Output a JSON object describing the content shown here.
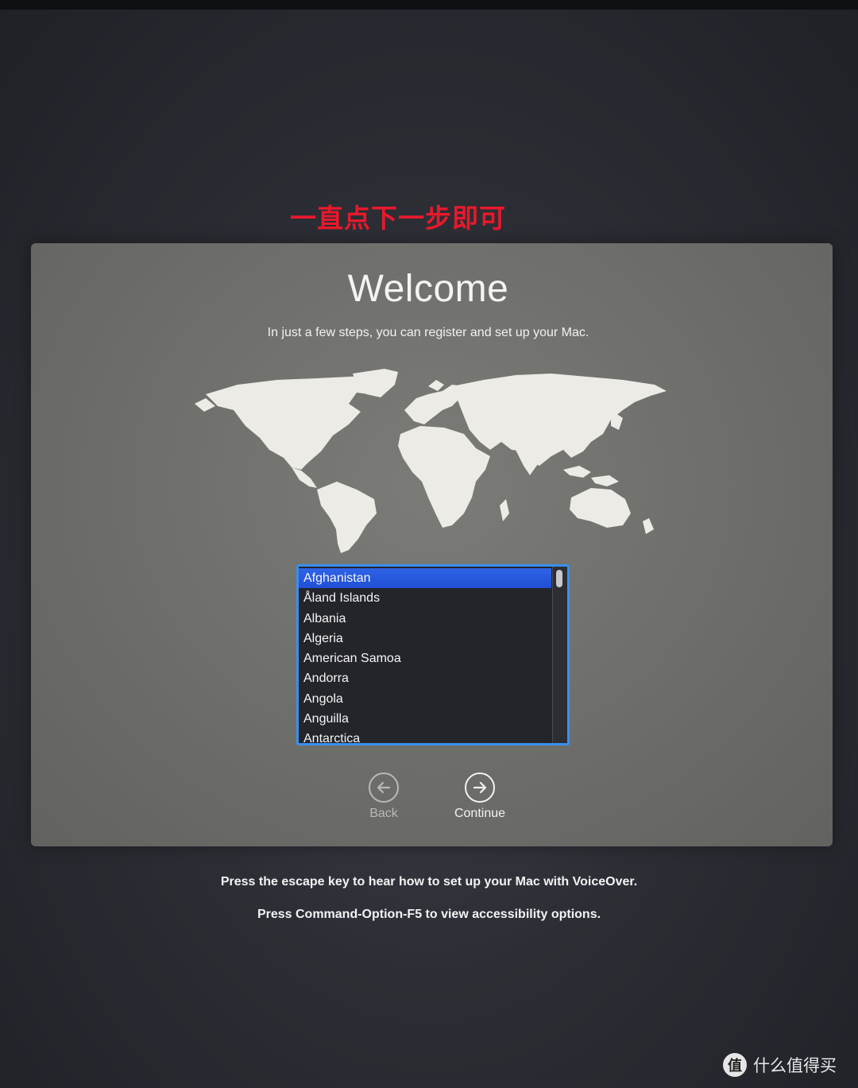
{
  "annotation": "一直点下一步即可",
  "welcome": {
    "title": "Welcome",
    "subtitle": "In just a few steps, you can register and set up your Mac."
  },
  "country_list": {
    "selected": "Afghanistan",
    "items": [
      "Afghanistan",
      "Åland Islands",
      "Albania",
      "Algeria",
      "American Samoa",
      "Andorra",
      "Angola",
      "Anguilla",
      "Antarctica"
    ]
  },
  "navigation": {
    "back_label": "Back",
    "continue_label": "Continue"
  },
  "footer": {
    "line1": "Press the escape key to hear how to set up your Mac with VoiceOver.",
    "line2": "Press Command-Option-F5 to view accessibility options."
  },
  "watermark": {
    "text": "什么值得买",
    "logo_glyph": "值"
  },
  "colors": {
    "selection": "#2f63e6",
    "list_border": "#3a8ff0",
    "annotation": "#e8192c"
  }
}
